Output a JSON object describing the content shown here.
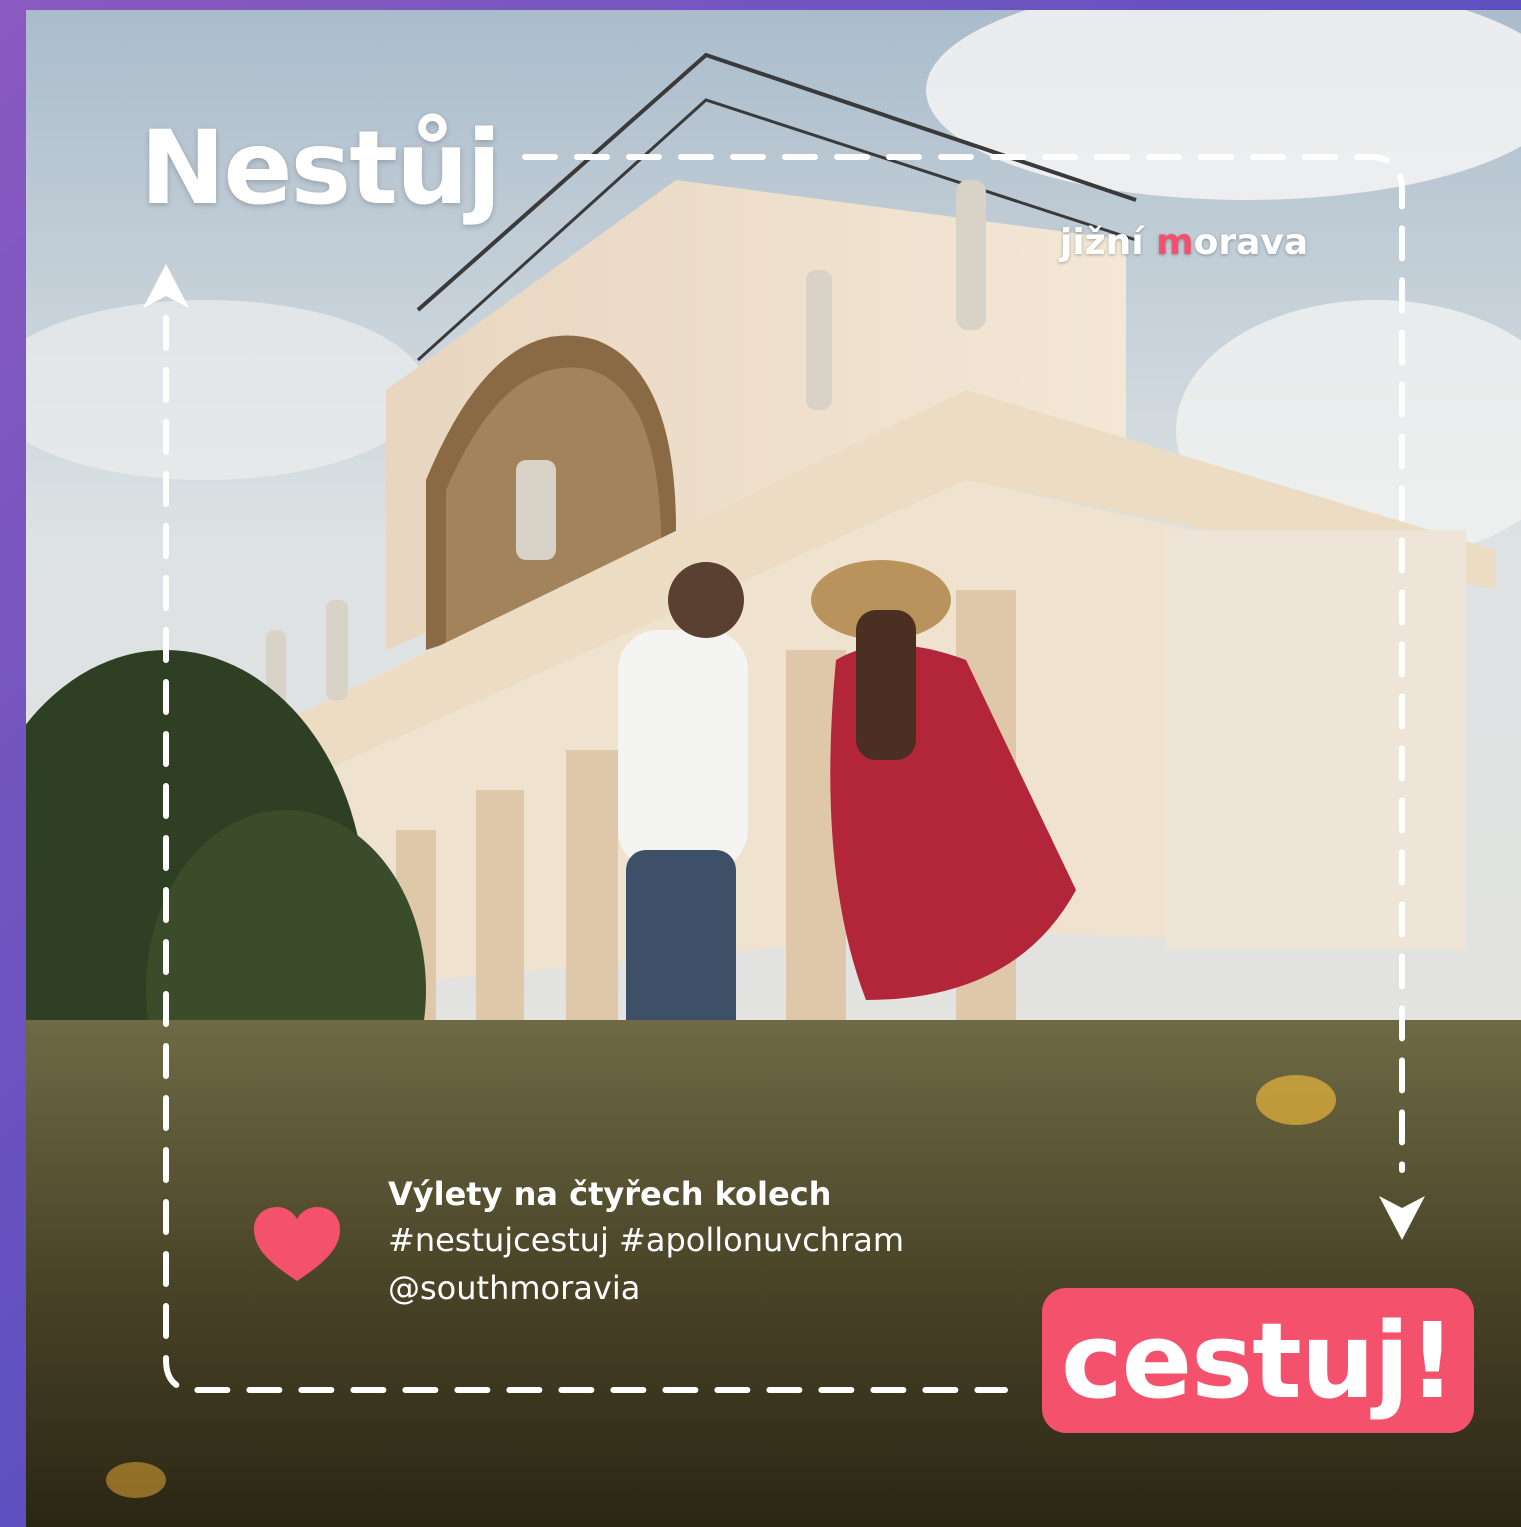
{
  "headline": "Nestůj",
  "logo": {
    "prefix": "jižní ",
    "accent": "m",
    "suffix": "orava"
  },
  "caption": {
    "title": "Výlety na čtyřech kolech",
    "hashtags": "#nestujcestuj #apollonuvchram",
    "handle": "@southmoravia"
  },
  "cta_label": "cestuj!",
  "icons": {
    "heart": "heart-icon",
    "arrow_up": "arrow-up-icon",
    "arrow_down": "arrow-down-icon"
  },
  "colors": {
    "accent": "#f4516d",
    "frame_purple": "#7d56c0",
    "text": "#ffffff"
  }
}
